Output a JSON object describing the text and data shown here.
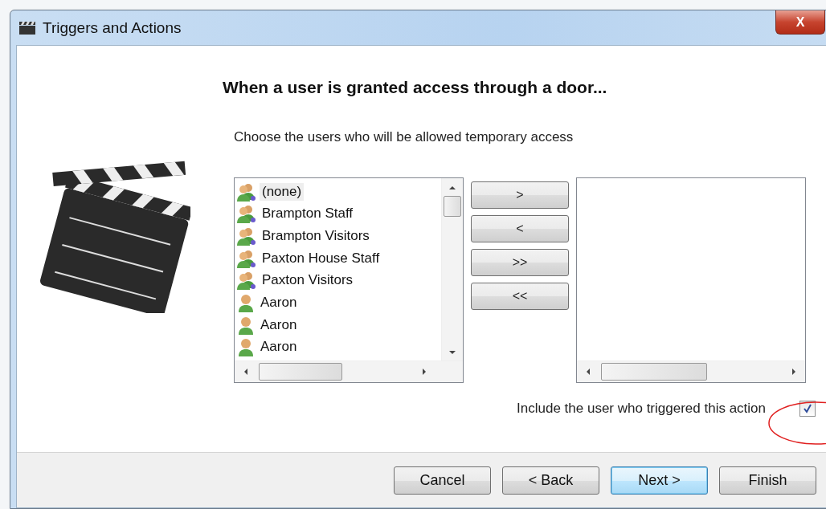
{
  "window": {
    "title": "Triggers and Actions",
    "close_label": "X"
  },
  "heading": "When a user is granted access through a door...",
  "instruction": "Choose the users who will be allowed temporary access",
  "available_list": {
    "items": [
      {
        "label": "(none)",
        "kind": "group",
        "selected": true
      },
      {
        "label": "Brampton Staff",
        "kind": "group",
        "selected": false
      },
      {
        "label": "Brampton Visitors",
        "kind": "group",
        "selected": false
      },
      {
        "label": "Paxton House Staff",
        "kind": "group",
        "selected": false
      },
      {
        "label": "Paxton Visitors",
        "kind": "group",
        "selected": false
      },
      {
        "label": "Aaron",
        "kind": "user",
        "selected": false
      },
      {
        "label": "Aaron",
        "kind": "user",
        "selected": false
      },
      {
        "label": "Aaron",
        "kind": "user",
        "selected": false
      }
    ]
  },
  "move_buttons": [
    ">",
    "<",
    ">>",
    "<<"
  ],
  "include_trigger_user": {
    "label": "Include the user who triggered this action",
    "checked": true
  },
  "footer_buttons": [
    {
      "label": "Cancel",
      "default": false
    },
    {
      "label": "< Back",
      "default": false
    },
    {
      "label": "Next >",
      "default": true
    },
    {
      "label": "Finish",
      "default": false
    }
  ]
}
